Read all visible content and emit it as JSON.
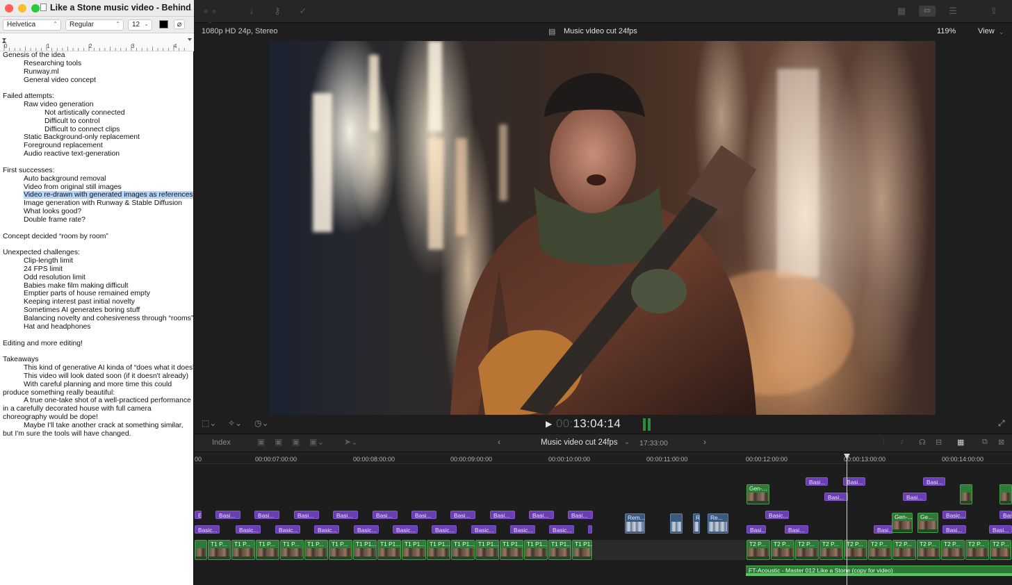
{
  "textedit": {
    "title": "Like a Stone music video - Behind...",
    "font_family": "Helvetica",
    "font_style": "Regular",
    "font_size": "12",
    "ruler_marks": [
      "0",
      "1",
      "2",
      "3",
      "4"
    ],
    "lines": [
      {
        "text": "Genesis of the idea",
        "indent": 0
      },
      {
        "text": "Researching tools",
        "indent": 1
      },
      {
        "text": "Runway.ml",
        "indent": 1
      },
      {
        "text": "General video concept",
        "indent": 1
      },
      {
        "text": "",
        "indent": 0
      },
      {
        "text": "Failed attempts:",
        "indent": 0
      },
      {
        "text": "Raw video generation",
        "indent": 1
      },
      {
        "text": "Not artistically connected",
        "indent": 2
      },
      {
        "text": "Difficult to control",
        "indent": 2
      },
      {
        "text": "Difficult to connect clips",
        "indent": 2
      },
      {
        "text": "Static Background-only replacement",
        "indent": 1
      },
      {
        "text": "Foreground replacement",
        "indent": 1
      },
      {
        "text": "Audio reactive text-generation",
        "indent": 1
      },
      {
        "text": "",
        "indent": 0
      },
      {
        "text": "First successes:",
        "indent": 0
      },
      {
        "text": "Auto background removal",
        "indent": 1
      },
      {
        "text": "Video from original still images",
        "indent": 1
      },
      {
        "text": "Video re-drawn with generated images as references",
        "indent": 1,
        "highlight": true
      },
      {
        "text": "Image generation with Runway & Stable Diffusion",
        "indent": 1
      },
      {
        "text": "What looks good?",
        "indent": 1
      },
      {
        "text": "Double frame rate?",
        "indent": 1
      },
      {
        "text": "",
        "indent": 0
      },
      {
        "text": "Concept decided “room by room”",
        "indent": 0
      },
      {
        "text": "",
        "indent": 0
      },
      {
        "text": "Unexpected challenges:",
        "indent": 0
      },
      {
        "text": "Clip-length limit",
        "indent": 1
      },
      {
        "text": "24 FPS limit",
        "indent": 1
      },
      {
        "text": "Odd resolution limit",
        "indent": 1
      },
      {
        "text": "Babies make film making difficult",
        "indent": 1
      },
      {
        "text": "Emptier parts of house remained empty",
        "indent": 1
      },
      {
        "text": "Keeping interest past initial novelty",
        "indent": 1
      },
      {
        "text": "Sometimes AI generates boring stuff",
        "indent": 1
      },
      {
        "text": "Balancing novelty and cohesiveness through “rooms”",
        "indent": 1
      },
      {
        "text": "Hat and headphones",
        "indent": 1
      },
      {
        "text": "",
        "indent": 0
      },
      {
        "text": "Editing and more editing!",
        "indent": 0
      },
      {
        "text": "",
        "indent": 0
      },
      {
        "text": "Takeaways",
        "indent": 0
      },
      {
        "text": "This kind of generative AI kinda of “does what it does”",
        "indent": 1
      },
      {
        "text": "This video will look dated soon (if it doesn't already)",
        "indent": 1
      },
      {
        "text": "With careful planning and more time this could produce something really beautiful:",
        "indent": 1,
        "hanging": true
      },
      {
        "text": "A true one-take shot of a well-practiced performance in a carefully decorated house with full camera choreography would be dope!",
        "indent": 1,
        "hanging": true
      },
      {
        "text": "Maybe I'll take another crack at something similar, but I'm sure the tools will have changed.",
        "indent": 1,
        "hanging": true
      }
    ]
  },
  "fcp": {
    "viewer_format": "1080p HD 24p, Stereo",
    "viewer_title": "Music video cut 24fps",
    "zoom": "119%",
    "view_label": "View",
    "timecode_dim": "00:",
    "timecode": "13:04:14",
    "index_label": "Index",
    "timeline_title": "Music video cut 24fps",
    "timeline_duration": "17:33:00",
    "ruler_ticks": [
      "00:00:07:00:00",
      "00:00:08:00:00",
      "00:00:09:00:00",
      "00:00:10:00:00",
      "00:00:11:00:00",
      "00:00:12:00:00",
      "00:00:13:00:00",
      "00:00:14:00:00"
    ],
    "ruler_short_left": "00",
    "basic_label": "Basic...",
    "basic_short": "Basi...",
    "green_main_label": "T1 P...",
    "green_main_label_b": "T1 P1...",
    "green_main_label_r": "T2 P...",
    "gen_label": "Gen-...",
    "gen_label_b": "Ge...",
    "rem_label": "Rem...",
    "re_label": "Re...",
    "re_short": "Re",
    "e_label": "E",
    "audio_label": "FT-Acoustic - Master 012 Like a Stone (copy for video)",
    "colors": {
      "purple_clip": "#6b3fb4",
      "green_clip": "#2f7a36",
      "audio_clip": "#2c7a33",
      "selection": "#b5d5fb"
    }
  }
}
